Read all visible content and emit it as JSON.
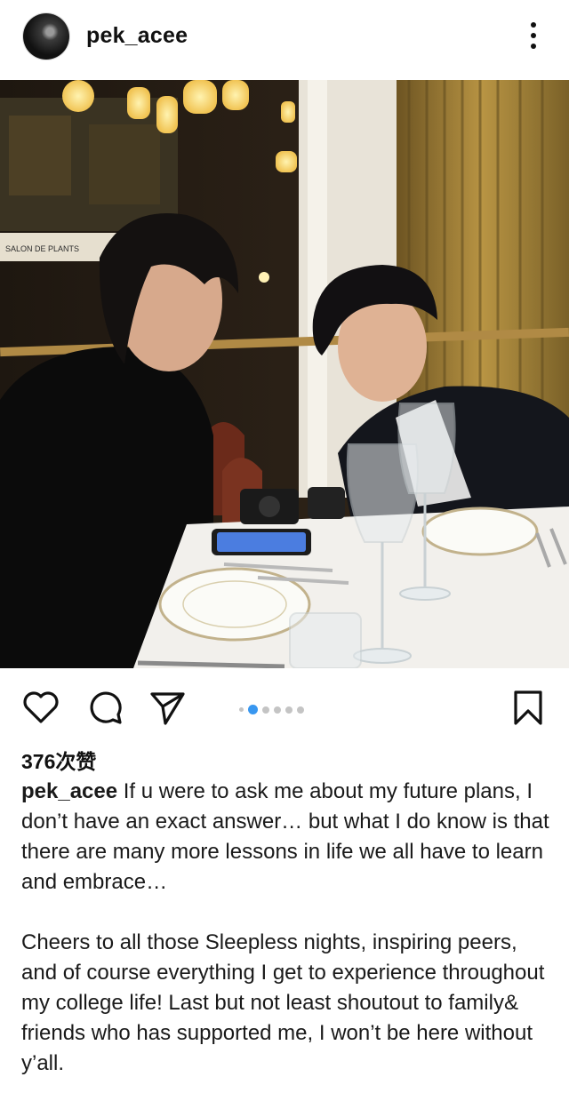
{
  "post": {
    "username": "pek_acee",
    "photo_sign": "SALON DE PLANTS",
    "likes": "376次赞",
    "caption_username": "pek_acee",
    "caption_p1": "If u were to ask me about my future plans, I don’t have an exact answer… but what I do know is that there are many more lessons in life we all have to learn and embrace…",
    "caption_p2": "Cheers to all those Sleepless nights, inspiring peers, and of course everything I get to experience throughout my college life!  Last but not least shoutout to family& friends who has supported me, I won’t be here without y’all."
  },
  "icons": {
    "avatar": "avatar",
    "more": "more-vertical-icon",
    "like": "heart-icon",
    "comment": "comment-icon",
    "share": "send-icon",
    "save": "bookmark-icon"
  },
  "carousel": {
    "count": 6,
    "active_index": 1
  },
  "colors": {
    "text": "#111111",
    "active_dot": "#3897f0",
    "inactive_dot": "#c4c4c4"
  }
}
